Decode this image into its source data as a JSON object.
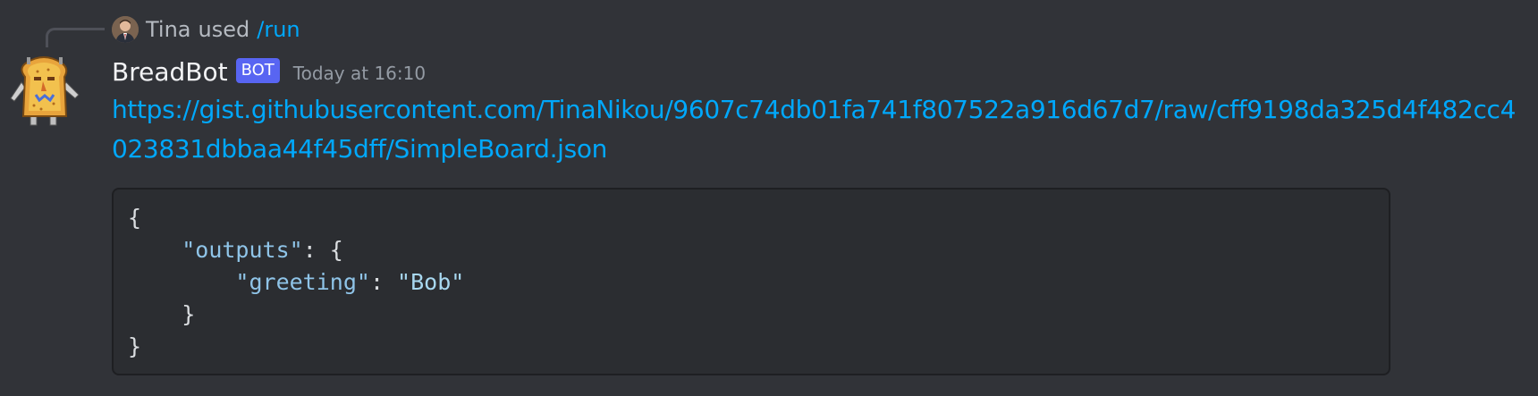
{
  "reply": {
    "user_name": "Tina",
    "used_text": "used",
    "command": "/run"
  },
  "message": {
    "author": "BreadBot",
    "bot_tag": "BOT",
    "timestamp": "Today at 16:10",
    "link": "https://gist.githubusercontent.com/TinaNikou/9607c74db01fa741f807522a916d67d7/raw/cff9198da325d4f482cc4023831dbbaa44f45dff/SimpleBoard.json"
  },
  "code_block": {
    "line1_open": "{",
    "line2_key": "\"outputs\"",
    "line2_rest": ": {",
    "line3_key": "\"greeting\"",
    "line3_sep": ": ",
    "line3_value": "\"Bob\"",
    "line4_close": "}",
    "line5_close": "}"
  },
  "colors": {
    "background": "#313338",
    "link": "#00a8fc",
    "bot_tag": "#5865f2",
    "code_bg": "#2b2d31"
  },
  "icons": {
    "reply_avatar": "user-avatar-photo",
    "bot_avatar": "breadbot-toast-avatar"
  }
}
